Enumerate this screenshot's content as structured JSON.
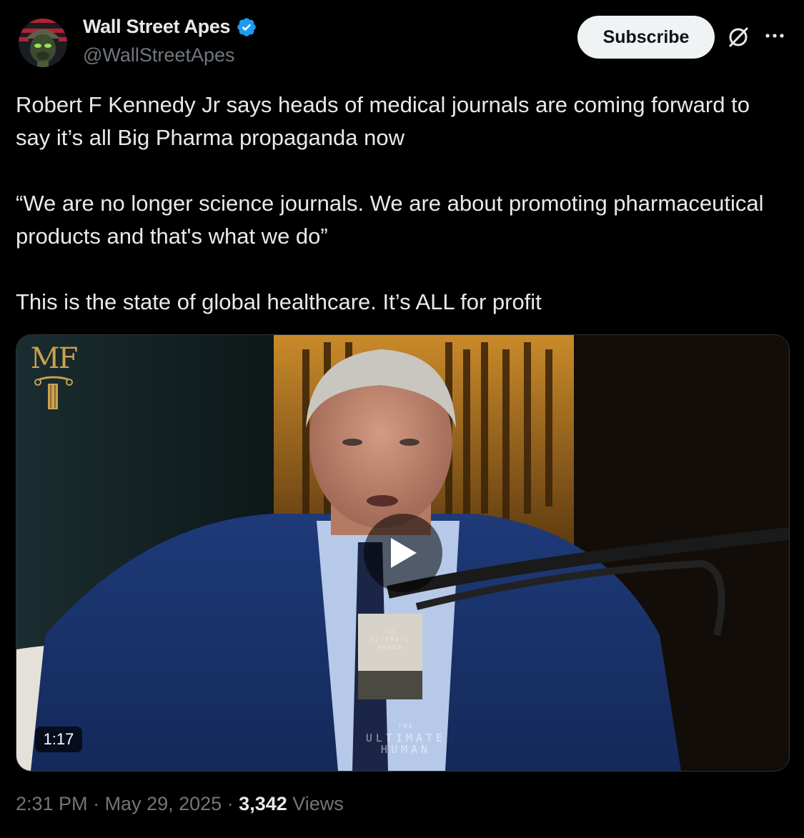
{
  "author": {
    "display_name": "Wall Street Apes",
    "handle": "@WallStreetApes",
    "verified_color": "#1d9bf0"
  },
  "actions": {
    "subscribe_label": "Subscribe",
    "grok_icon": "grok-icon",
    "more_icon": "more-icon"
  },
  "tweet": {
    "paragraphs": [
      "Robert F Kennedy Jr says heads of medical journals are coming forward to say it’s all Big Pharma propaganda now",
      "“We are no longer science journals. We are about promoting pharmaceutical products and that's what we do”",
      "This is the state of global healthcare. It’s ALL for profit"
    ]
  },
  "video": {
    "duration": "1:17",
    "logo_text": "MF",
    "mic_label_top": "THE",
    "mic_label_mid": "ULTIMATE",
    "mic_label_bottom": "HUMAN",
    "watermark_top": "THE",
    "watermark_mid": "ULTIMATE",
    "watermark_bottom": "HUMAN"
  },
  "meta": {
    "time": "2:31 PM",
    "separator": " · ",
    "date": "May 29, 2025",
    "views_count": "3,342",
    "views_label": "Views"
  }
}
